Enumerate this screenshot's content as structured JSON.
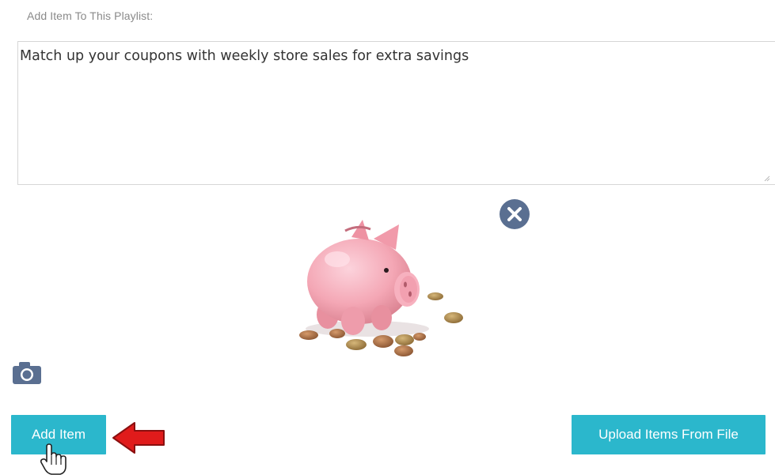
{
  "form": {
    "heading": "Add Item To This Playlist:",
    "item_text": "Match up your coupons with weekly store sales for extra savings"
  },
  "image": {
    "alt": "piggy bank with coins",
    "remove_icon": "close-icon"
  },
  "camera": {
    "icon": "camera-icon"
  },
  "buttons": {
    "add_label": "Add Item",
    "upload_label": "Upload Items From File"
  },
  "colors": {
    "button_bg": "#2bb7cc",
    "close_icon_bg": "#5a6f91",
    "arrow": "#e01b1b",
    "piggy_pink": "#f4a7b5"
  }
}
